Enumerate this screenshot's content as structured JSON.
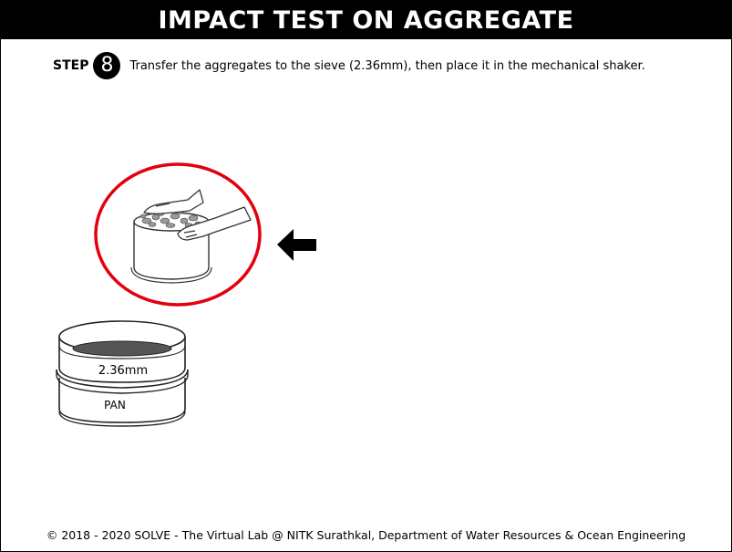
{
  "header": {
    "title": "IMPACT TEST ON AGGREGATE"
  },
  "step": {
    "label": "STEP",
    "number": "8",
    "instruction": "Transfer the aggregates to the sieve (2.36mm), then place it in the mechanical shaker."
  },
  "illustration": {
    "sieve_label": "2.36mm",
    "pan_label": "PAN",
    "highlight_color": "#e3000f"
  },
  "footer": {
    "text": "© 2018 - 2020 SOLVE - The Virtual Lab @ NITK Surathkal, Department of Water Resources & Ocean Engineering"
  }
}
